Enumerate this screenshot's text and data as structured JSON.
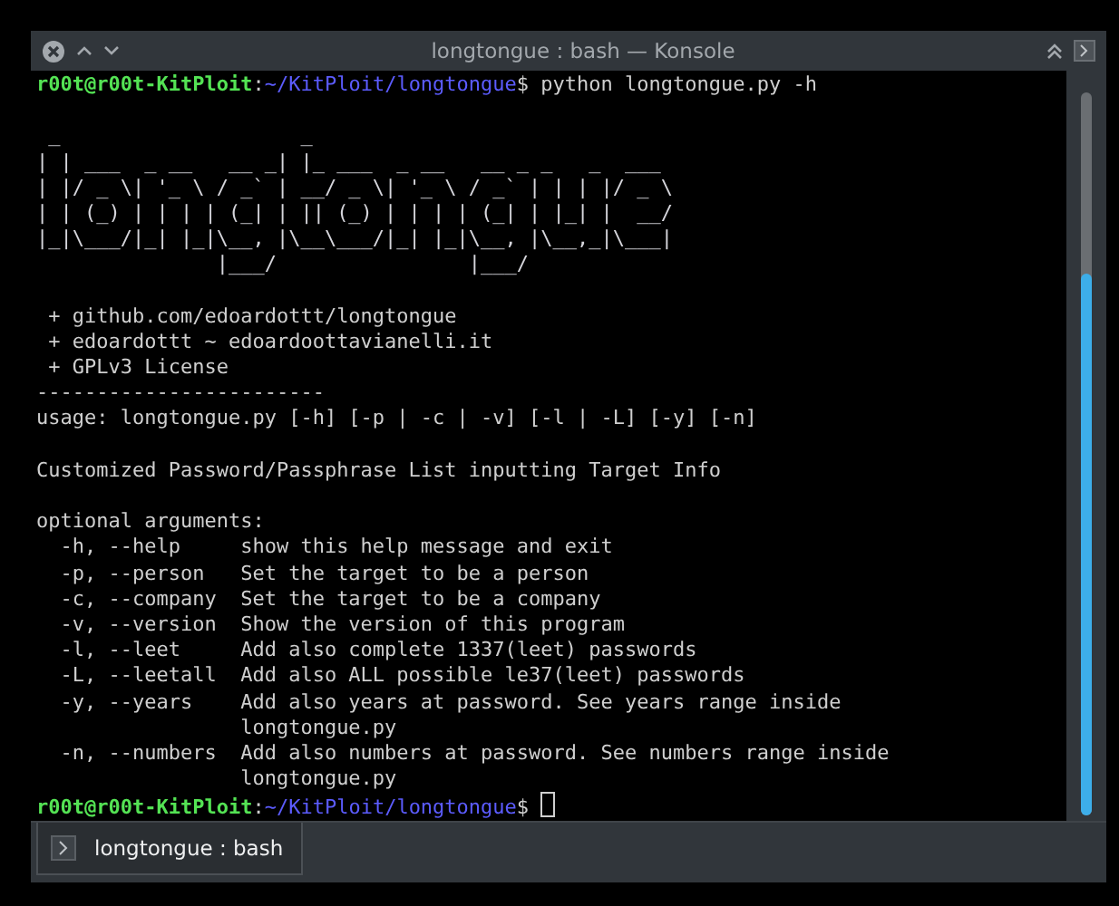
{
  "window": {
    "title": "longtongue : bash — Konsole"
  },
  "terminal": {
    "lines": [
      {
        "kind": "prompt",
        "user": "r00t@r00t-KitPloit",
        "separator": ":",
        "path": "~/KitPloit/longtongue",
        "symbol": "$",
        "command": " python longtongue.py -h",
        "cursor": false
      },
      {
        "kind": "blank"
      },
      {
        "kind": "art",
        "text": " _                    _"
      },
      {
        "kind": "art",
        "text": "| | ___  _ __   __ _| |_ ___  _ __   __ _ _   _  ___"
      },
      {
        "kind": "art",
        "text": "| |/ _ \\| '_ \\ / _` | __/ _ \\| '_ \\ / _` | | | |/ _ \\"
      },
      {
        "kind": "art",
        "text": "| | (_) | | | | (_| | || (_) | | | | (_| | |_| |  __/"
      },
      {
        "kind": "art",
        "text": "|_|\\___/|_| |_|\\__, |\\__\\___/|_| |_|\\__, |\\__,_|\\___|"
      },
      {
        "kind": "art",
        "text": "               |___/                |___/"
      },
      {
        "kind": "blank"
      },
      {
        "kind": "text",
        "text": " + github.com/edoardottt/longtongue"
      },
      {
        "kind": "text",
        "text": " + edoardottt ~ edoardoottavianelli.it"
      },
      {
        "kind": "text",
        "text": " + GPLv3 License"
      },
      {
        "kind": "text",
        "text": "------------------------"
      },
      {
        "kind": "text",
        "text": "usage: longtongue.py [-h] [-p | -c | -v] [-l | -L] [-y] [-n]"
      },
      {
        "kind": "blank"
      },
      {
        "kind": "text",
        "text": "Customized Password/Passphrase List inputting Target Info"
      },
      {
        "kind": "blank"
      },
      {
        "kind": "text",
        "text": "optional arguments:"
      },
      {
        "kind": "text",
        "text": "  -h, --help     show this help message and exit"
      },
      {
        "kind": "text",
        "text": "  -p, --person   Set the target to be a person"
      },
      {
        "kind": "text",
        "text": "  -c, --company  Set the target to be a company"
      },
      {
        "kind": "text",
        "text": "  -v, --version  Show the version of this program"
      },
      {
        "kind": "text",
        "text": "  -l, --leet     Add also complete 1337(leet) passwords"
      },
      {
        "kind": "text",
        "text": "  -L, --leetall  Add also ALL possible le37(leet) passwords"
      },
      {
        "kind": "text",
        "text": "  -y, --years    Add also years at password. See years range inside"
      },
      {
        "kind": "text",
        "text": "                 longtongue.py"
      },
      {
        "kind": "text",
        "text": "  -n, --numbers  Add also numbers at password. See numbers range inside"
      },
      {
        "kind": "text",
        "text": "                 longtongue.py"
      },
      {
        "kind": "prompt",
        "user": "r00t@r00t-KitPloit",
        "separator": ":",
        "path": "~/KitPloit/longtongue",
        "symbol": "$",
        "cursor": true
      }
    ]
  },
  "tabs": [
    {
      "label": "longtongue : bash",
      "selected": true
    }
  ]
}
